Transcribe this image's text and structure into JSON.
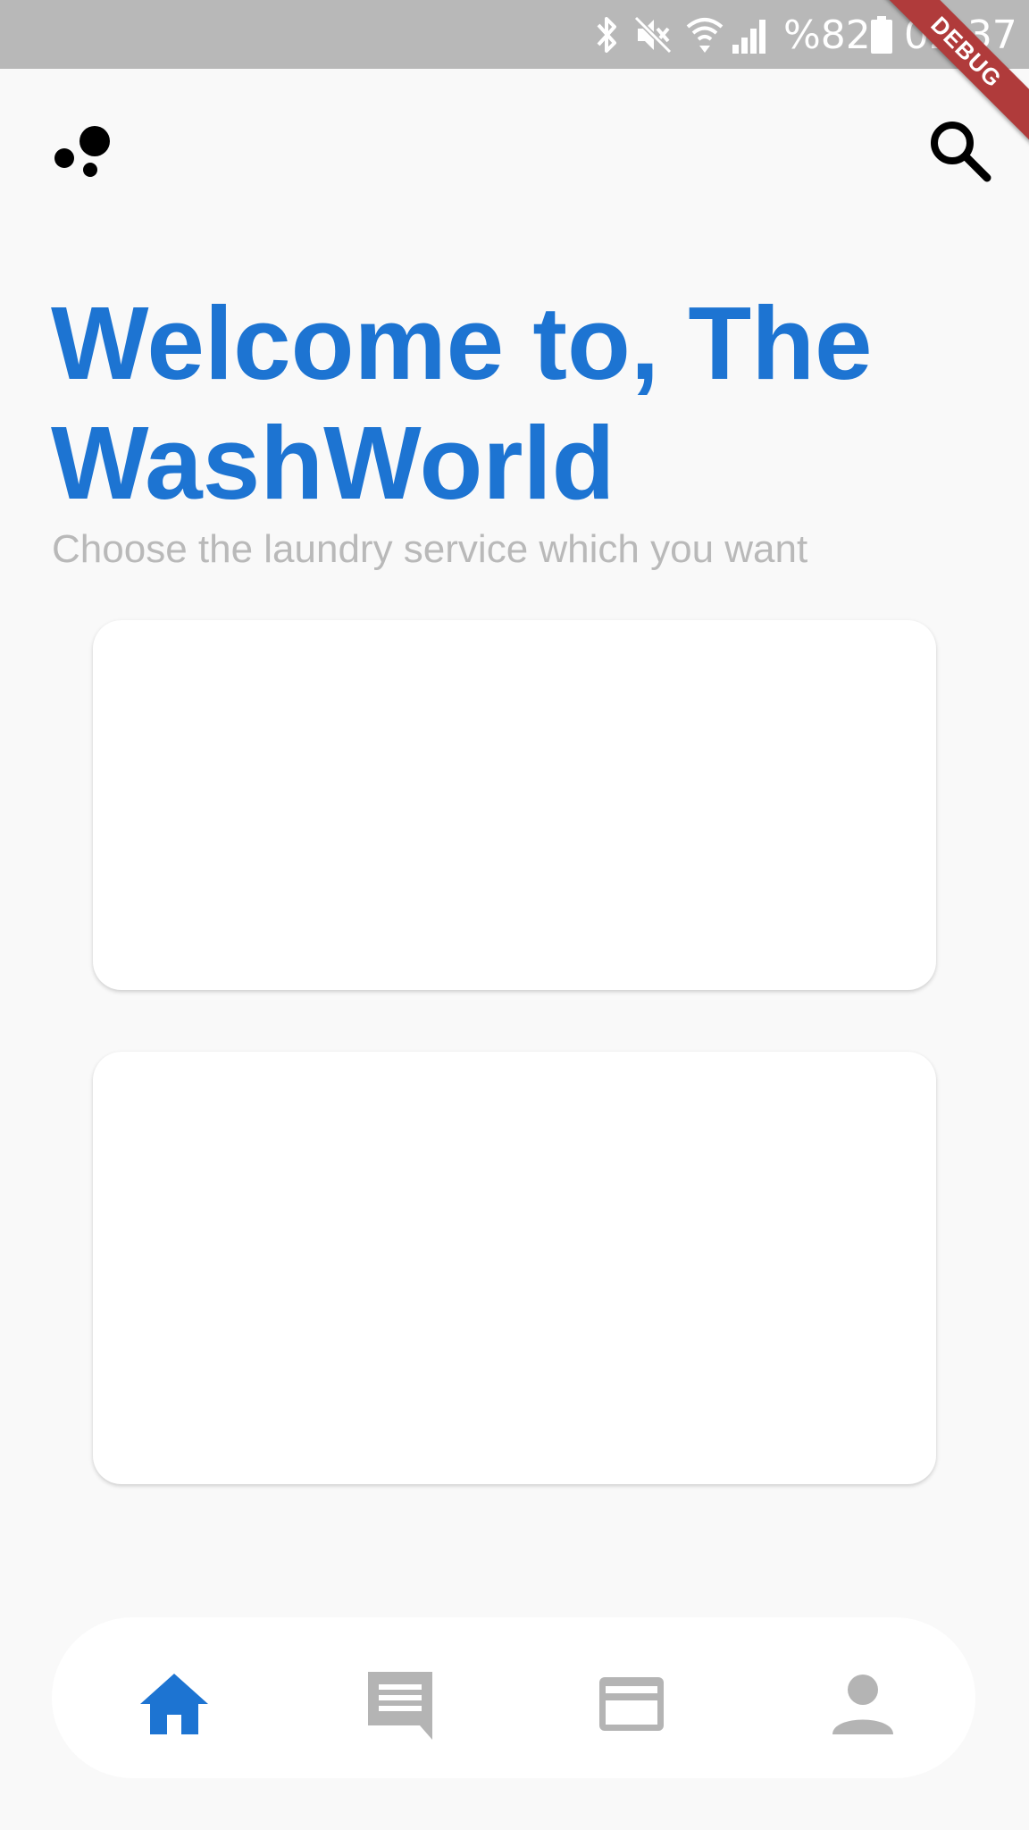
{
  "status_bar": {
    "battery_text": "%82",
    "time": "02:37",
    "icons": [
      "bluetooth-icon",
      "mute-icon",
      "wifi-icon",
      "signal-icon",
      "battery-icon"
    ]
  },
  "debug_banner": "DEBUG",
  "header": {
    "logo_icon": "dots-logo-icon",
    "search_icon": "search-icon"
  },
  "hero": {
    "title": "Welcome to, The WashWorld",
    "subtitle": "Choose the laundry service which you want"
  },
  "bottom_nav": {
    "items": [
      {
        "icon": "home-icon",
        "active": true
      },
      {
        "icon": "chat-icon",
        "active": false
      },
      {
        "icon": "card-icon",
        "active": false
      },
      {
        "icon": "profile-icon",
        "active": false
      }
    ]
  },
  "colors": {
    "accent": "#1d74d2",
    "inactive_icon": "#b4b4b4",
    "status_bar": "#b8b8b8",
    "background": "#f9f9f9",
    "debug_banner": "#b03b3b"
  }
}
